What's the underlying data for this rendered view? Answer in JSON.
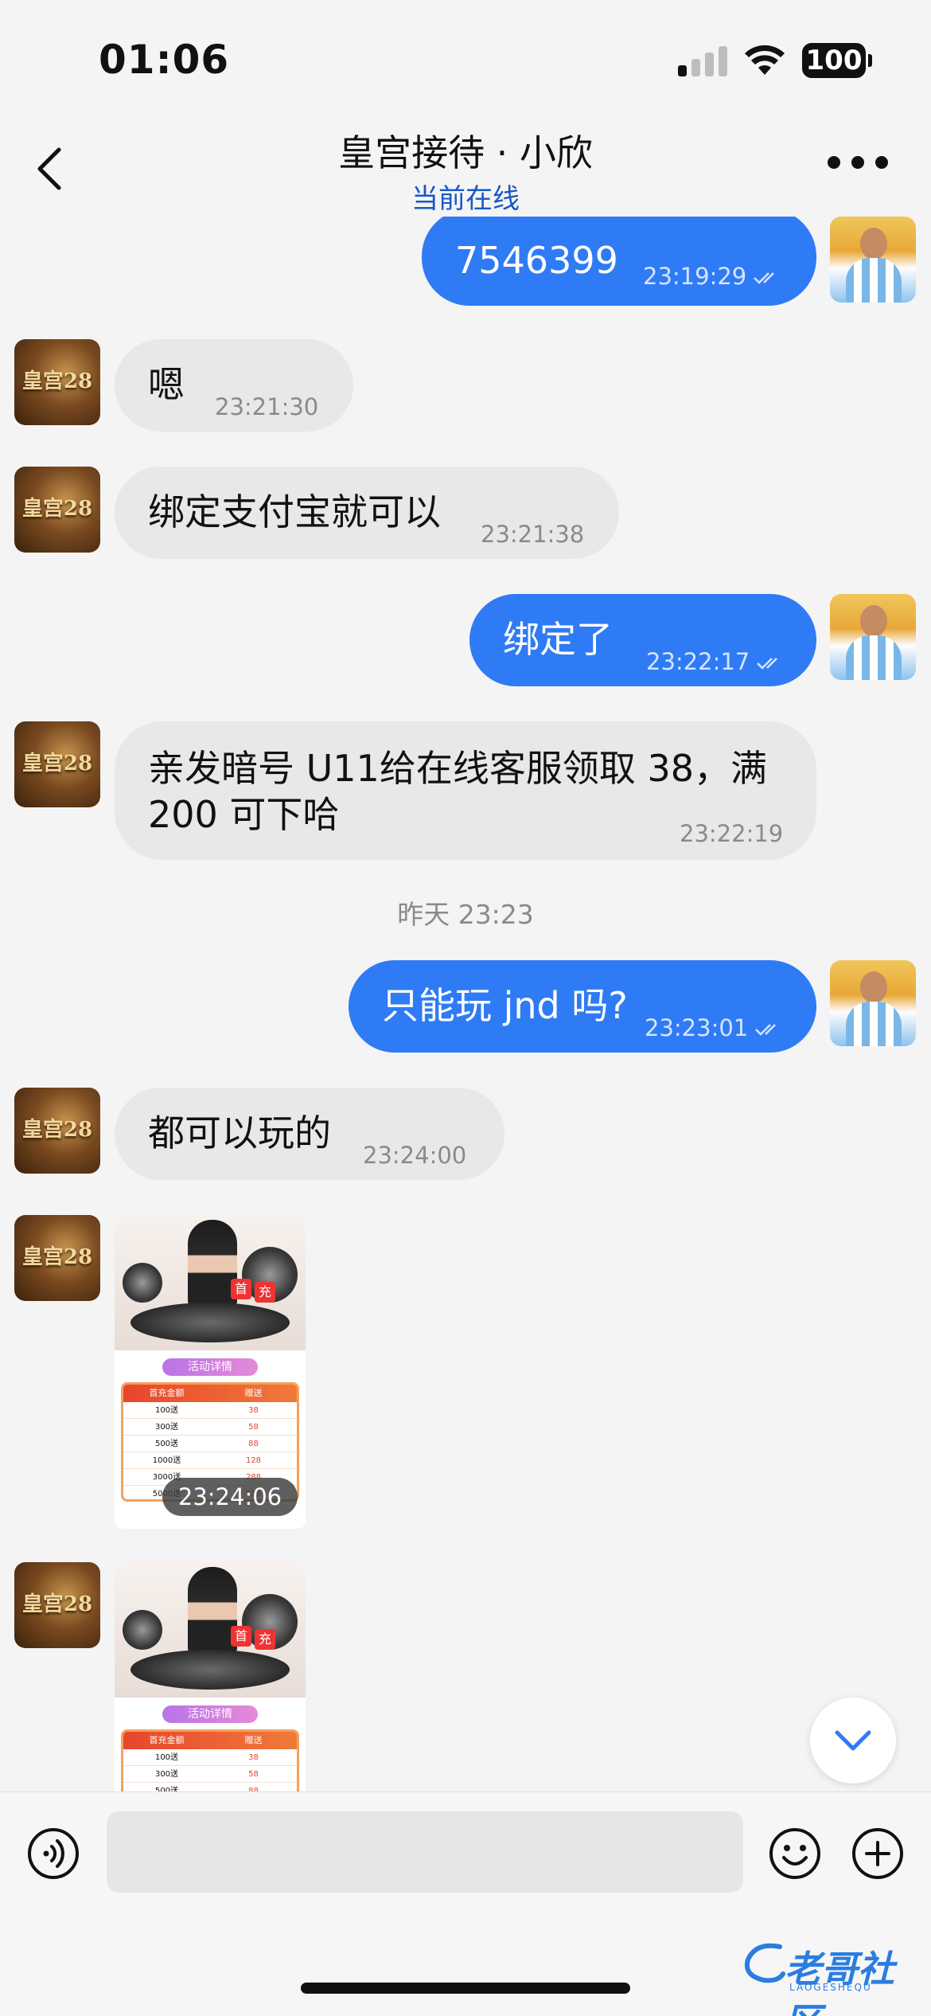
{
  "status_bar": {
    "time": "01:06",
    "battery": "100"
  },
  "header": {
    "title": "皇宫接待 · 小欣",
    "subtitle": "当前在线"
  },
  "brand_avatar_text": "皇宫28",
  "messages": [
    {
      "dir": "out",
      "text": "7546399",
      "time": "23:19:29"
    },
    {
      "dir": "in",
      "text": "嗯",
      "time": "23:21:30"
    },
    {
      "dir": "in",
      "text": "绑定支付宝就可以",
      "time": "23:21:38"
    },
    {
      "dir": "out",
      "text": "绑定了",
      "time": "23:22:17"
    },
    {
      "dir": "in",
      "text": "亲发暗号 U11给在线客服领取 38，满\n200 可下哈",
      "time": "23:22:19"
    },
    {
      "dir": "out",
      "text": "只能玩 jnd 吗?",
      "time": "23:23:01"
    },
    {
      "dir": "in",
      "text": "都可以玩的",
      "time": "23:24:00"
    }
  ],
  "date_separator": "昨天 23:23",
  "image_messages": [
    {
      "time": "23:24:06"
    },
    {
      "time": ""
    }
  ],
  "promo": {
    "badges": [
      "首",
      "充"
    ],
    "ribbon": "活动详情",
    "table_header": [
      "首充金额",
      "赠送"
    ],
    "rows": [
      [
        "100送",
        "38"
      ],
      [
        "300送",
        "58"
      ],
      [
        "500送",
        "88"
      ],
      [
        "1000送",
        "128"
      ],
      [
        "3000送",
        "288"
      ],
      [
        "5000送",
        "588"
      ]
    ]
  },
  "input": {
    "placeholder": ""
  },
  "watermark": {
    "text": "老哥社区",
    "sub": "LAOGESHEQU"
  },
  "colors": {
    "accent": "#2f7bf5",
    "subtitle": "#1a57c5",
    "incoming_bubble": "#e8e8ea"
  }
}
